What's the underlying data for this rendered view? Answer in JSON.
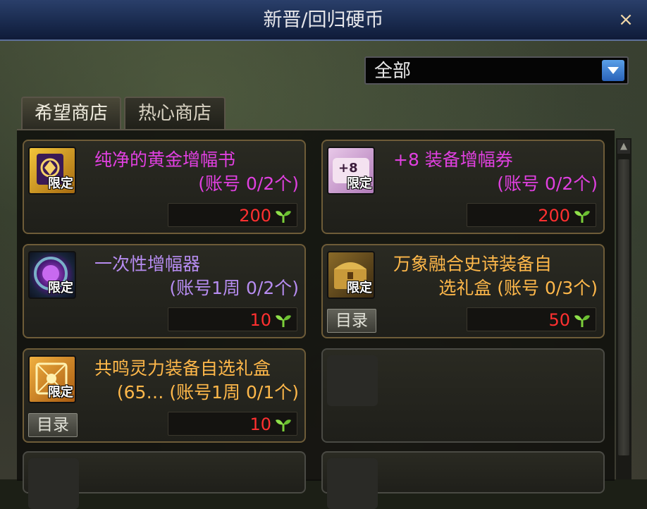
{
  "window": {
    "title": "新晋/回归硬币",
    "close_icon": "×"
  },
  "filter": {
    "selected": "全部"
  },
  "tabs": [
    {
      "label": "希望商店"
    },
    {
      "label": "热心商店"
    }
  ],
  "items": [
    {
      "name": "纯净的黄金增幅书",
      "limit": "(账号 0/2个)",
      "badge": "限定",
      "price": "200",
      "color": "#e040e0",
      "icon": "gold-scroll-icon"
    },
    {
      "name": "+8 装备增幅券",
      "limit": "(账号 0/2个)",
      "badge": "限定",
      "price": "200",
      "color": "#e040e0",
      "icon": "plus8-voucher-icon"
    },
    {
      "name": "一次性增幅器",
      "limit": "(账号1周 0/2个)",
      "badge": "限定",
      "price": "10",
      "color": "#b68cf0",
      "icon": "amplifier-orb-icon"
    },
    {
      "name": "万象融合史诗装备自",
      "limit": "选礼盒 (账号 0/3个)",
      "badge": "限定",
      "price": "50",
      "catalog": "目录",
      "color": "#ffb84a",
      "icon": "treasure-chest-icon"
    },
    {
      "name": "共鸣灵力装备自选礼盒",
      "limit": "(65… (账号1周 0/1个)",
      "badge": "限定",
      "price": "10",
      "catalog": "目录",
      "color": "#ffb84a",
      "icon": "resonance-box-icon"
    }
  ],
  "currency_icon": "sprout-icon"
}
